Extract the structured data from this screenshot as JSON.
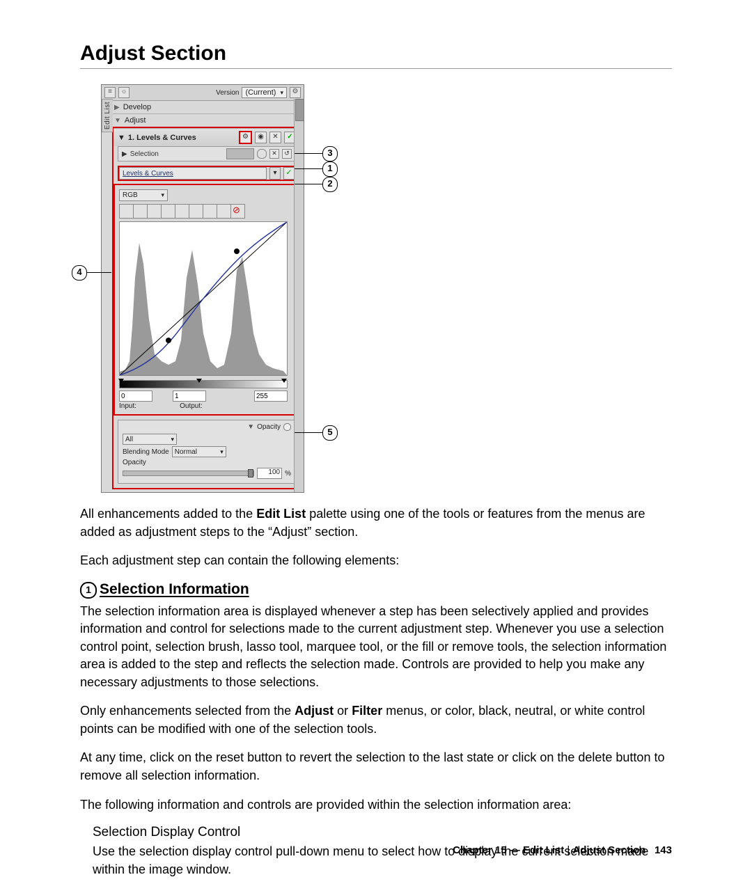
{
  "title": "Adjust Section",
  "panel": {
    "tab": "Edit List",
    "version_label": "Version",
    "version_value": "(Current)",
    "develop": "Develop",
    "adjust_header": "Adjust",
    "step_title": "1. Levels & Curves",
    "selection_label": "Selection",
    "levels_dd": "Levels & Curves",
    "rgb": "RGB",
    "num_a": "0",
    "num_b": "1",
    "num_c": "255",
    "input_label": "Input:",
    "output_label": "Output:",
    "opacity_header": "Opacity",
    "op_dd1": "All",
    "blend_label": "Blending Mode",
    "blend_value": "Normal",
    "opacity_label": "Opacity",
    "opacity_value": "100",
    "opacity_unit": "%"
  },
  "callouts": {
    "c1": "1",
    "c2": "2",
    "c3": "3",
    "c4": "4",
    "c5": "5"
  },
  "paragraphs": {
    "p1a": "All enhancements added to the ",
    "p1b": "Edit List",
    "p1c": " palette using one of the tools or features from the menus are added as adjustment steps to the “Adjust” section.",
    "p2": "Each adjustment step can contain the following elements:",
    "h2_num": "1",
    "h2": "Selection Information",
    "p3": "The selection information area is displayed whenever a step has been selectively applied and provides information and control for selections made to the current adjustment step. Whenever you use a selection control point, selection brush, lasso tool, marquee tool, or the fill or remove tools, the selection information area is added to the step and reflects the selection made. Controls are provided to help you make any necessary adjustments to those selections.",
    "p4a": "Only enhancements selected from the ",
    "p4b": "Adjust",
    "p4c": " or ",
    "p4d": "Filter",
    "p4e": " menus, or color, black, neutral, or white control points can be modified with one of the selection tools.",
    "p5": "At any time, click on the reset button to revert the selection to the last state or click on the delete button to remove all selection information.",
    "p6": "The following information and controls are provided within the selection information area:",
    "h3": "Selection Display Control",
    "p7": "Use the selection display control pull-down menu to select how to display the current selection made within the image window."
  },
  "footer": {
    "a": "Chapter 15 — Edit List",
    "sep": " | ",
    "b": "Adjust Section",
    "page": "143"
  }
}
